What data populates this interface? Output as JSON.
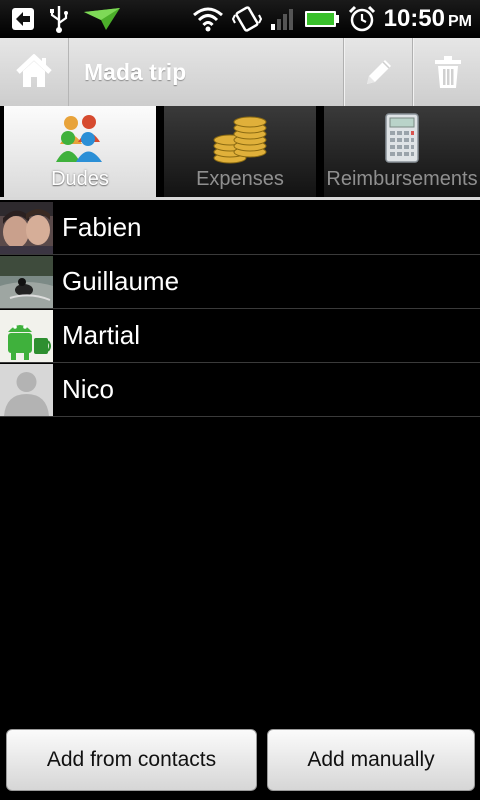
{
  "status_bar": {
    "time": "10:50",
    "ampm": "PM",
    "icons": [
      "back-arrow-notification-icon",
      "usb-icon",
      "plane-notification-icon",
      "wifi-icon",
      "vibrate-icon",
      "signal-icon",
      "battery-icon",
      "alarm-icon"
    ]
  },
  "action_bar": {
    "title": "Mada trip",
    "icons": [
      "home-icon",
      "pencil-icon",
      "trash-icon"
    ]
  },
  "tabs": [
    {
      "label": "Dudes",
      "icon": "people-icon",
      "selected": true
    },
    {
      "label": "Expenses",
      "icon": "coins-icon",
      "selected": false
    },
    {
      "label": "Reimbursements",
      "icon": "calculator-icon",
      "selected": false
    }
  ],
  "dudes": [
    {
      "name": "Fabien"
    },
    {
      "name": "Guillaume"
    },
    {
      "name": "Martial"
    },
    {
      "name": "Nico"
    }
  ],
  "buttons": {
    "add_from_contacts": "Add from contacts",
    "add_manually": "Add manually"
  },
  "colors": {
    "background": "#000000",
    "action_bar": "#d9d9d9",
    "battery_green": "#39c02b"
  }
}
